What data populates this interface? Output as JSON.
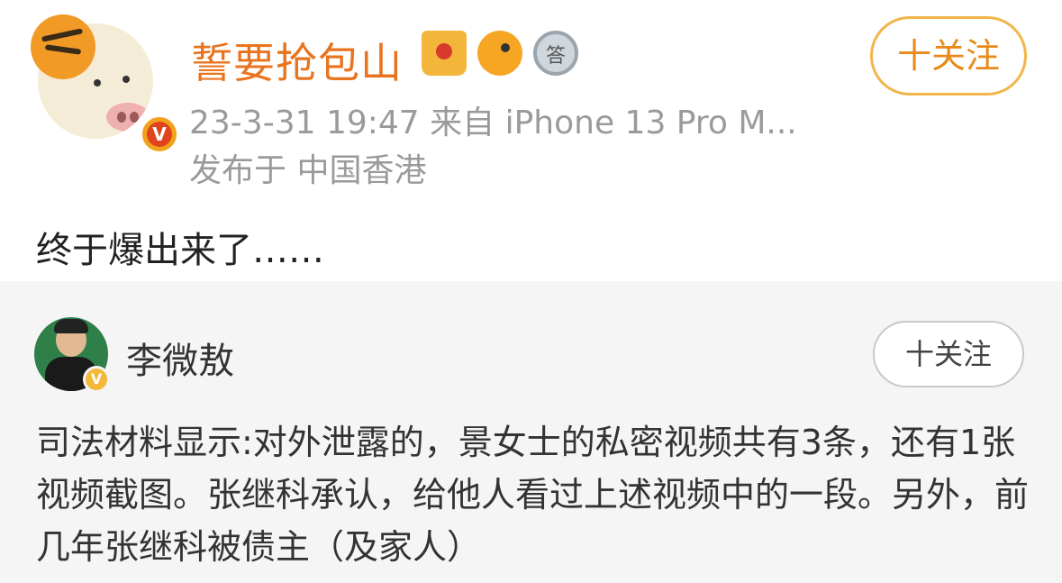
{
  "post": {
    "username": "誓要抢包山",
    "meta_time_source": "23-3-31 19:47  来自 iPhone 13 Pro M...",
    "meta_location": "发布于 中国香港",
    "follow_label": "十关注",
    "content": "终于爆出来了……",
    "badges": [
      "crown-badge-icon",
      "fish-badge-icon",
      "medal-badge-icon"
    ],
    "colors": {
      "username": "#e8741f",
      "follow_border": "#f0b64a",
      "meta": "#9a9a9a"
    }
  },
  "repost": {
    "name": "李微敖",
    "follow_label": "十关注",
    "content": "司法材料显示:对外泄露的，景女士的私密视频共有3条，还有1张视频截图。张继科承认，给他人看过上述视频中的一段。另外，前几年张继科被债主（及家人）",
    "colors": {
      "background": "#f5f5f5"
    }
  }
}
